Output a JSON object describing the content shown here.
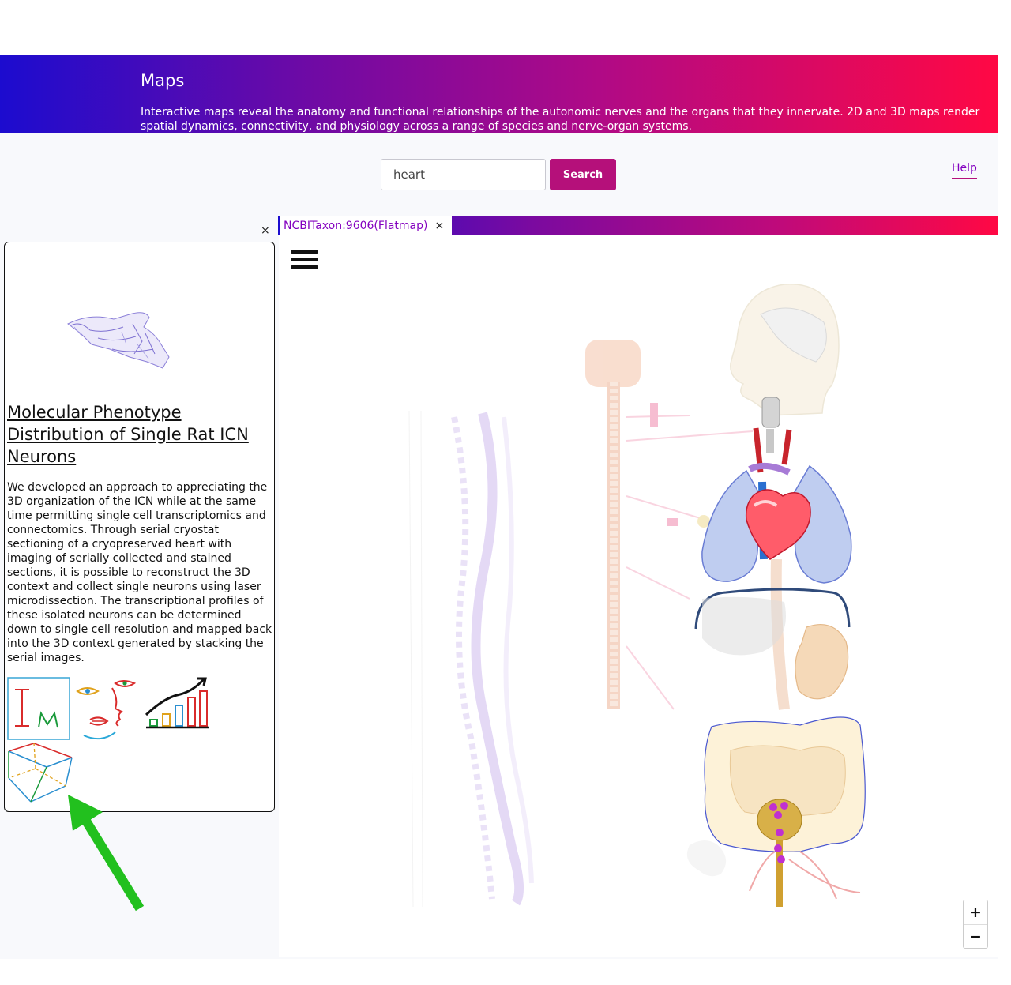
{
  "header": {
    "title": "Maps",
    "description": "Interactive maps reveal the anatomy and functional relationships of the autonomic nerves and the organs that they innervate. 2D and 3D maps render spatial dynamics, connectivity, and physiology across a range of species and nerve-organ systems."
  },
  "search": {
    "value": "heart",
    "button_label": "Search"
  },
  "help_label": "Help",
  "sidebar": {
    "close_label": "×",
    "card": {
      "title": "Molecular Phenotype Distribution of Single Rat ICN Neurons",
      "description": "We developed an approach to appreciating the 3D organization of the ICN while at the same time permitting single cell transcriptomics and connectomics. Through serial cryostat sectioning of a cryopreserved heart with imaging of serially collected and stained sections, it is possible to reconstruct the 3D context and collect single neurons using laser microdissection. The transcriptional profiles of these isolated neurons can be determined down to single cell resolution and mapped back into the 3D context generated by stacking the serial images.",
      "tool_icons": [
        "image-viewer-icon",
        "face-viewer-icon",
        "plot-viewer-icon",
        "scaffold-viewer-icon"
      ]
    }
  },
  "tab": {
    "label": "NCBITaxon:9606(Flatmap)",
    "close_label": "×"
  },
  "zoom": {
    "in_label": "+",
    "out_label": "−"
  },
  "colors": {
    "accent": "#8300bf",
    "brand": "#b5107a",
    "gradient_start": "#1c0ccf",
    "gradient_end": "#ff0844",
    "annotation_arrow": "#22c01e"
  }
}
